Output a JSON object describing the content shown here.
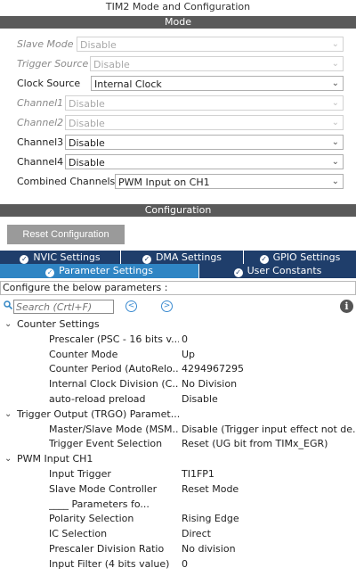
{
  "window_title": "TIM2 Mode and Configuration",
  "mode_header": "Mode",
  "config_header": "Configuration",
  "mode_rows": [
    {
      "label": "Slave Mode",
      "value": "Disable",
      "disabled": true
    },
    {
      "label": "Trigger Source",
      "value": "Disable",
      "disabled": true
    },
    {
      "label": "Clock Source",
      "value": "Internal Clock",
      "disabled": false
    },
    {
      "label": "Channel1",
      "value": "Disable",
      "disabled": true
    },
    {
      "label": "Channel2",
      "value": "Disable",
      "disabled": true
    },
    {
      "label": "Channel3",
      "value": "Disable",
      "disabled": false
    },
    {
      "label": "Channel4",
      "value": "Disable",
      "disabled": false
    },
    {
      "label": "Combined Channels",
      "value": "PWM Input on CH1",
      "disabled": false
    }
  ],
  "reset_button": "Reset Configuration",
  "tabs_row1": [
    "NVIC Settings",
    "DMA Settings",
    "GPIO Settings"
  ],
  "tabs_row2": [
    "Parameter Settings",
    "User Constants"
  ],
  "hint": "Configure the below parameters :",
  "search": {
    "placeholder": "Search (Crtl+F)"
  },
  "icons": {
    "search": "magnifier-icon",
    "prev": "chevron-left-icon",
    "next": "chevron-right-icon",
    "info": "info-icon",
    "check": "check-icon",
    "dropdown": "chevron-down-icon"
  },
  "colors": {
    "tab_dark": "#1f3e6b",
    "tab_active": "#2f85c4",
    "band": "#5a5a5a",
    "button": "#9a9a9a"
  },
  "tree": [
    {
      "type": "group",
      "name": "Counter Settings"
    },
    {
      "type": "param",
      "name": "Prescaler (PSC - 16 bits v...",
      "value": "0"
    },
    {
      "type": "param",
      "name": "Counter Mode",
      "value": "Up"
    },
    {
      "type": "param",
      "name": "Counter Period (AutoRelo...",
      "value": "4294967295"
    },
    {
      "type": "param",
      "name": "Internal Clock Division (C...",
      "value": "No Division"
    },
    {
      "type": "param",
      "name": "auto-reload preload",
      "value": "Disable"
    },
    {
      "type": "group",
      "name": "Trigger Output (TRGO) Paramet..."
    },
    {
      "type": "param",
      "name": "Master/Slave Mode (MSM...",
      "value": "Disable (Trigger input effect not de..."
    },
    {
      "type": "param",
      "name": "Trigger Event Selection",
      "value": "Reset (UG bit from TIMx_EGR)"
    },
    {
      "type": "group",
      "name": "PWM Input CH1"
    },
    {
      "type": "param",
      "name": "Input Trigger",
      "value": "TI1FP1"
    },
    {
      "type": "param",
      "name": "Slave Mode Controller",
      "value": "Reset Mode"
    },
    {
      "type": "param",
      "name": "____ Parameters fo...",
      "value": ""
    },
    {
      "type": "param",
      "name": "Polarity Selection",
      "value": "Rising Edge"
    },
    {
      "type": "param",
      "name": "IC Selection",
      "value": "Direct"
    },
    {
      "type": "param",
      "name": "Prescaler Division Ratio",
      "value": "No division"
    },
    {
      "type": "param",
      "name": "Input Filter (4 bits value)",
      "value": "0"
    }
  ]
}
